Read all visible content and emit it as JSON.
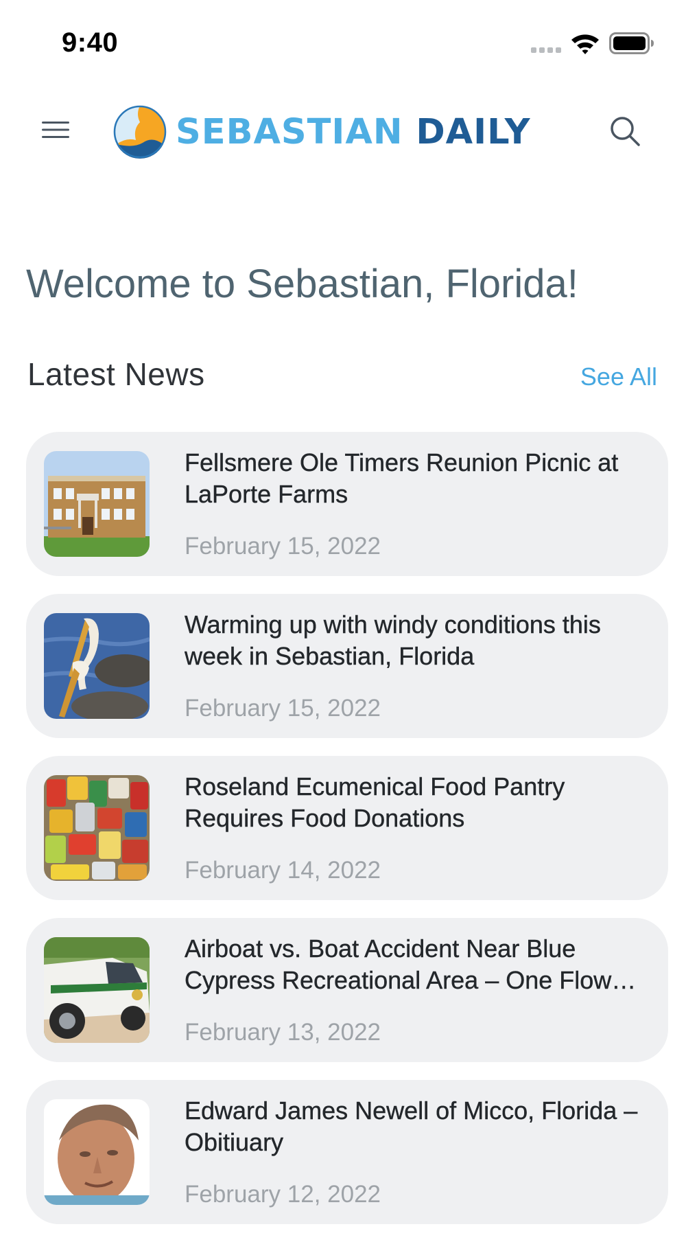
{
  "status_bar": {
    "time": "9:40",
    "icons": [
      "cellular-signal-icon",
      "wifi-icon",
      "battery-icon"
    ]
  },
  "header": {
    "logo_word_1": "SEBASTIAN",
    "logo_word_2": "DAILY",
    "menu_icon": "hamburger-menu-icon",
    "search_icon": "search-icon"
  },
  "colors": {
    "accent": "#45a7e0",
    "logo_light": "#4eaee3",
    "logo_dark": "#1f5c95",
    "heading": "#4f6470",
    "card_bg": "#eff0f2",
    "date_text": "#9ea3a8"
  },
  "welcome": {
    "title": "Welcome to Sebastian, Florida!"
  },
  "latest_news": {
    "heading": "Latest News",
    "see_all_label": "See All",
    "items": [
      {
        "title": "Fellsmere Ole Timers Reunion Picnic at LaPorte Farms",
        "date": "February 15, 2022",
        "thumbnail": "school-building-photo"
      },
      {
        "title": "Warming up with windy conditions this week in Sebastian, Florida",
        "date": "February 15, 2022",
        "thumbnail": "pelicans-photo"
      },
      {
        "title": "Roseland Ecumenical Food Pantry Requires Food Donations",
        "date": "February 14, 2022",
        "thumbnail": "canned-food-photo"
      },
      {
        "title": "Airboat vs. Boat Accident Near Blue Cypress Recreational Area – One Flow…",
        "date": "February 13, 2022",
        "thumbnail": "fwc-truck-photo"
      },
      {
        "title": "Edward James Newell of Micco, Florida – Obitiuary",
        "date": "February 12, 2022",
        "thumbnail": "portrait-photo"
      }
    ]
  }
}
